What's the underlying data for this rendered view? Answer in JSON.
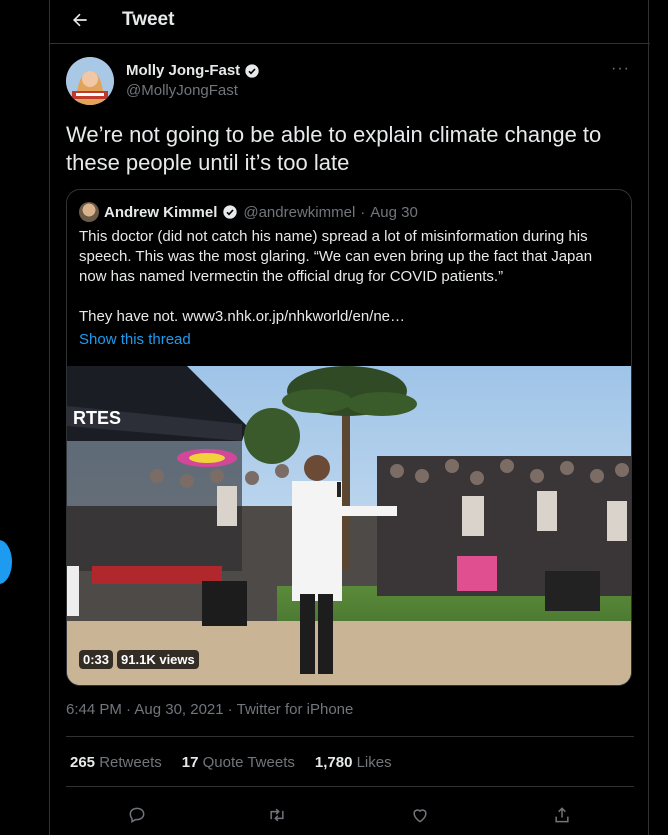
{
  "header": {
    "title": "Tweet",
    "back_icon": "arrow-left-icon"
  },
  "author": {
    "name": "Molly Jong-Fast",
    "handle": "@MollyJongFast",
    "verified_icon": "verified-badge-icon"
  },
  "tweet": {
    "text": "We’re not going to be able to explain climate change to these people until it’s too late",
    "timestamp": "6:44 PM · Aug 30, 2021",
    "source": "Twitter for iPhone"
  },
  "quote": {
    "name": "Andrew Kimmel",
    "handle": "@andrewkimmel",
    "date": "Aug 30",
    "paragraph1": "This doctor (did not catch his name) spread a lot of misinformation during his speech. This was the most glaring.  “We can even bring up the fact that Japan now has named Ivermectin the official drug for COVID patients.”",
    "paragraph2": "They have not. www3.nhk.or.jp/nhkworld/en/ne…",
    "show_thread": "Show this thread",
    "video_duration": "0:33",
    "video_views": "91.1K views"
  },
  "stats": {
    "retweets_count": "265",
    "retweets_label": "Retweets",
    "quotes_count": "17",
    "quotes_label": "Quote Tweets",
    "likes_count": "1,780",
    "likes_label": "Likes"
  },
  "colors": {
    "background": "#000000",
    "text": "#e7e9ea",
    "secondary": "#71767b",
    "accent": "#1d9bf0",
    "border": "#2f3336"
  }
}
